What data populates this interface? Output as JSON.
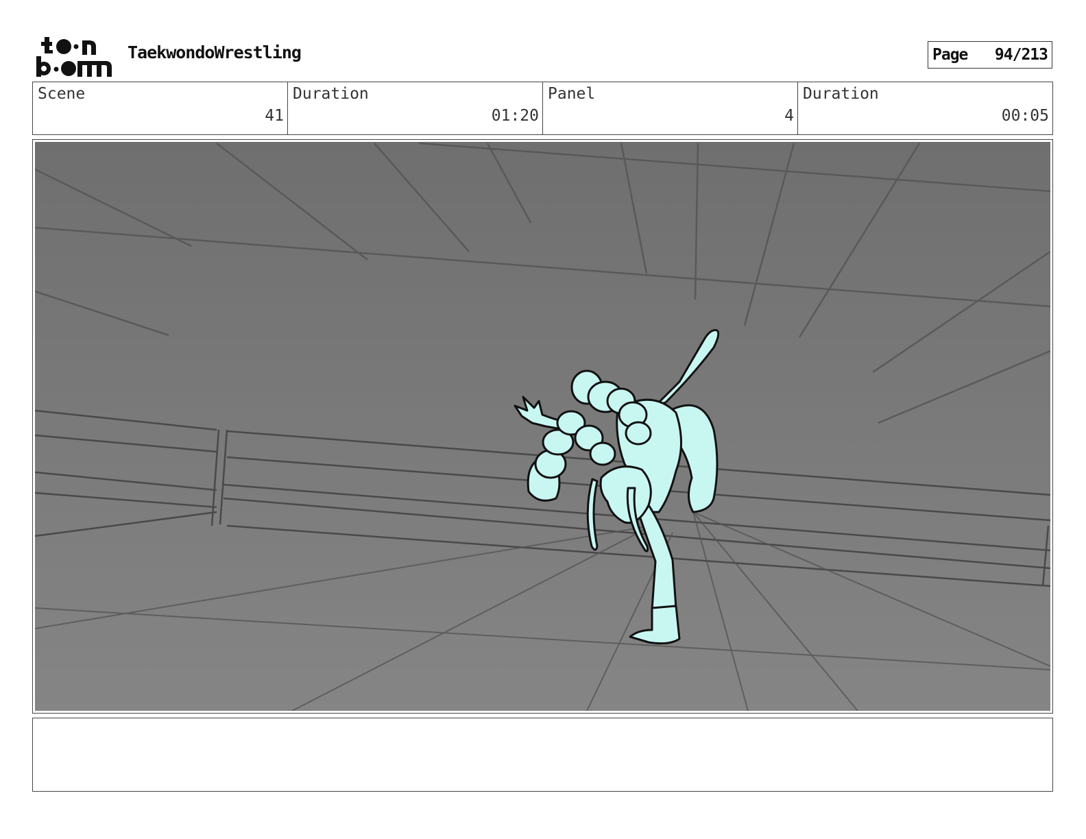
{
  "header": {
    "logo": {
      "line1": "toon",
      "line2": "boom"
    },
    "project_title": "TaekwondoWrestling",
    "page": {
      "label": "Page",
      "number": "94/213"
    }
  },
  "info": {
    "scene": {
      "label": "Scene",
      "value": "41"
    },
    "scene_duration": {
      "label": "Duration",
      "value": "01:20"
    },
    "panel": {
      "label": "Panel",
      "value": "4"
    },
    "panel_duration": {
      "label": "Duration",
      "value": "00:05"
    }
  },
  "notes": {
    "text": ""
  },
  "colors": {
    "background": "#7f7f7f",
    "character_fill": "#c8f7f2",
    "line": "#111111"
  }
}
